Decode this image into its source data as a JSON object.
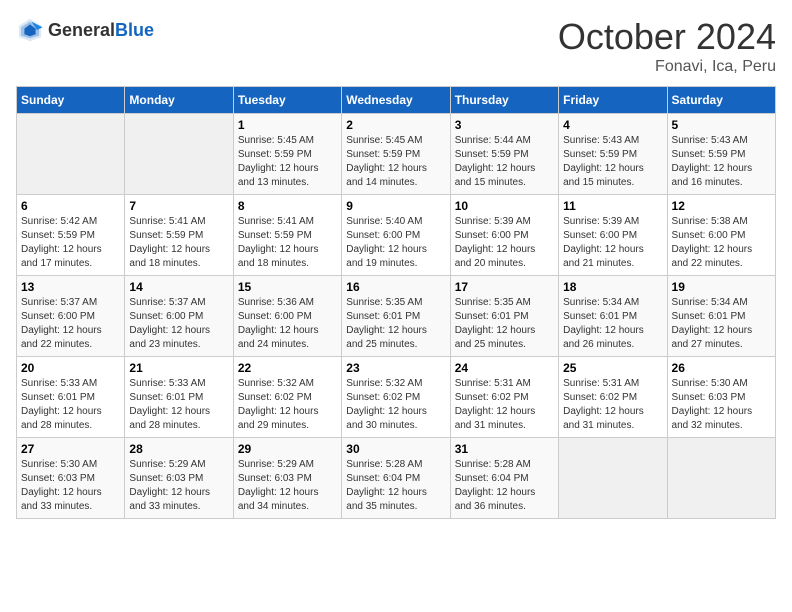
{
  "logo": {
    "general": "General",
    "blue": "Blue"
  },
  "title": "October 2024",
  "subtitle": "Fonavi, Ica, Peru",
  "days_header": [
    "Sunday",
    "Monday",
    "Tuesday",
    "Wednesday",
    "Thursday",
    "Friday",
    "Saturday"
  ],
  "weeks": [
    [
      {
        "day": "",
        "info": ""
      },
      {
        "day": "",
        "info": ""
      },
      {
        "day": "1",
        "info": "Sunrise: 5:45 AM\nSunset: 5:59 PM\nDaylight: 12 hours and 13 minutes."
      },
      {
        "day": "2",
        "info": "Sunrise: 5:45 AM\nSunset: 5:59 PM\nDaylight: 12 hours and 14 minutes."
      },
      {
        "day": "3",
        "info": "Sunrise: 5:44 AM\nSunset: 5:59 PM\nDaylight: 12 hours and 15 minutes."
      },
      {
        "day": "4",
        "info": "Sunrise: 5:43 AM\nSunset: 5:59 PM\nDaylight: 12 hours and 15 minutes."
      },
      {
        "day": "5",
        "info": "Sunrise: 5:43 AM\nSunset: 5:59 PM\nDaylight: 12 hours and 16 minutes."
      }
    ],
    [
      {
        "day": "6",
        "info": "Sunrise: 5:42 AM\nSunset: 5:59 PM\nDaylight: 12 hours and 17 minutes."
      },
      {
        "day": "7",
        "info": "Sunrise: 5:41 AM\nSunset: 5:59 PM\nDaylight: 12 hours and 18 minutes."
      },
      {
        "day": "8",
        "info": "Sunrise: 5:41 AM\nSunset: 5:59 PM\nDaylight: 12 hours and 18 minutes."
      },
      {
        "day": "9",
        "info": "Sunrise: 5:40 AM\nSunset: 6:00 PM\nDaylight: 12 hours and 19 minutes."
      },
      {
        "day": "10",
        "info": "Sunrise: 5:39 AM\nSunset: 6:00 PM\nDaylight: 12 hours and 20 minutes."
      },
      {
        "day": "11",
        "info": "Sunrise: 5:39 AM\nSunset: 6:00 PM\nDaylight: 12 hours and 21 minutes."
      },
      {
        "day": "12",
        "info": "Sunrise: 5:38 AM\nSunset: 6:00 PM\nDaylight: 12 hours and 22 minutes."
      }
    ],
    [
      {
        "day": "13",
        "info": "Sunrise: 5:37 AM\nSunset: 6:00 PM\nDaylight: 12 hours and 22 minutes."
      },
      {
        "day": "14",
        "info": "Sunrise: 5:37 AM\nSunset: 6:00 PM\nDaylight: 12 hours and 23 minutes."
      },
      {
        "day": "15",
        "info": "Sunrise: 5:36 AM\nSunset: 6:00 PM\nDaylight: 12 hours and 24 minutes."
      },
      {
        "day": "16",
        "info": "Sunrise: 5:35 AM\nSunset: 6:01 PM\nDaylight: 12 hours and 25 minutes."
      },
      {
        "day": "17",
        "info": "Sunrise: 5:35 AM\nSunset: 6:01 PM\nDaylight: 12 hours and 25 minutes."
      },
      {
        "day": "18",
        "info": "Sunrise: 5:34 AM\nSunset: 6:01 PM\nDaylight: 12 hours and 26 minutes."
      },
      {
        "day": "19",
        "info": "Sunrise: 5:34 AM\nSunset: 6:01 PM\nDaylight: 12 hours and 27 minutes."
      }
    ],
    [
      {
        "day": "20",
        "info": "Sunrise: 5:33 AM\nSunset: 6:01 PM\nDaylight: 12 hours and 28 minutes."
      },
      {
        "day": "21",
        "info": "Sunrise: 5:33 AM\nSunset: 6:01 PM\nDaylight: 12 hours and 28 minutes."
      },
      {
        "day": "22",
        "info": "Sunrise: 5:32 AM\nSunset: 6:02 PM\nDaylight: 12 hours and 29 minutes."
      },
      {
        "day": "23",
        "info": "Sunrise: 5:32 AM\nSunset: 6:02 PM\nDaylight: 12 hours and 30 minutes."
      },
      {
        "day": "24",
        "info": "Sunrise: 5:31 AM\nSunset: 6:02 PM\nDaylight: 12 hours and 31 minutes."
      },
      {
        "day": "25",
        "info": "Sunrise: 5:31 AM\nSunset: 6:02 PM\nDaylight: 12 hours and 31 minutes."
      },
      {
        "day": "26",
        "info": "Sunrise: 5:30 AM\nSunset: 6:03 PM\nDaylight: 12 hours and 32 minutes."
      }
    ],
    [
      {
        "day": "27",
        "info": "Sunrise: 5:30 AM\nSunset: 6:03 PM\nDaylight: 12 hours and 33 minutes."
      },
      {
        "day": "28",
        "info": "Sunrise: 5:29 AM\nSunset: 6:03 PM\nDaylight: 12 hours and 33 minutes."
      },
      {
        "day": "29",
        "info": "Sunrise: 5:29 AM\nSunset: 6:03 PM\nDaylight: 12 hours and 34 minutes."
      },
      {
        "day": "30",
        "info": "Sunrise: 5:28 AM\nSunset: 6:04 PM\nDaylight: 12 hours and 35 minutes."
      },
      {
        "day": "31",
        "info": "Sunrise: 5:28 AM\nSunset: 6:04 PM\nDaylight: 12 hours and 36 minutes."
      },
      {
        "day": "",
        "info": ""
      },
      {
        "day": "",
        "info": ""
      }
    ]
  ]
}
